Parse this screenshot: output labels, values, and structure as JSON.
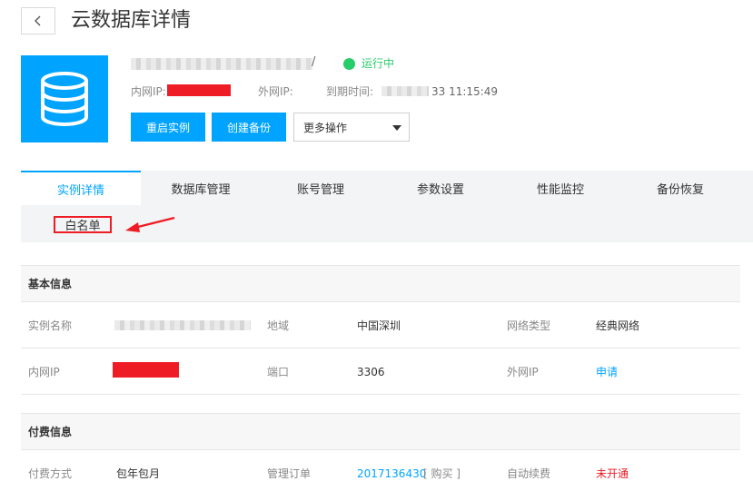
{
  "header": {
    "title": "云数据库详情"
  },
  "instance": {
    "name_suffix": "/",
    "status": "运行中",
    "labels": {
      "inner_ip": "内网IP:",
      "outer_ip": "外网IP:",
      "expire": "到期时间:"
    },
    "expire_tail": "33 11:15:49"
  },
  "actions": {
    "restart": "重启实例",
    "backup": "创建备份",
    "more": "更多操作"
  },
  "tabs": [
    {
      "label": "实例详情",
      "active": true
    },
    {
      "label": "数据库管理"
    },
    {
      "label": "账号管理"
    },
    {
      "label": "参数设置"
    },
    {
      "label": "性能监控"
    },
    {
      "label": "备份恢复"
    }
  ],
  "subtab": {
    "whitelist": "白名单"
  },
  "basic": {
    "title": "基本信息",
    "instance_name_label": "实例名称",
    "region_label": "地域",
    "region": "中国深圳",
    "network_type_label": "网络类型",
    "network_type": "经典网络",
    "inner_ip_label": "内网IP",
    "port_label": "端口",
    "port": "3306",
    "outer_ip_label": "外网IP",
    "outer_ip_action": "申请"
  },
  "billing": {
    "title": "付费信息",
    "pay_method_label": "付费方式",
    "pay_method": "包年包月",
    "order_label": "管理订单",
    "order": "2017136430",
    "order_suffix": "[ 购买 ]",
    "renew_label": "自动续费",
    "renew": "未开通"
  },
  "colors": {
    "accent": "#00a4ff",
    "running": "#29cc6a",
    "alert": "#ee1c25"
  }
}
